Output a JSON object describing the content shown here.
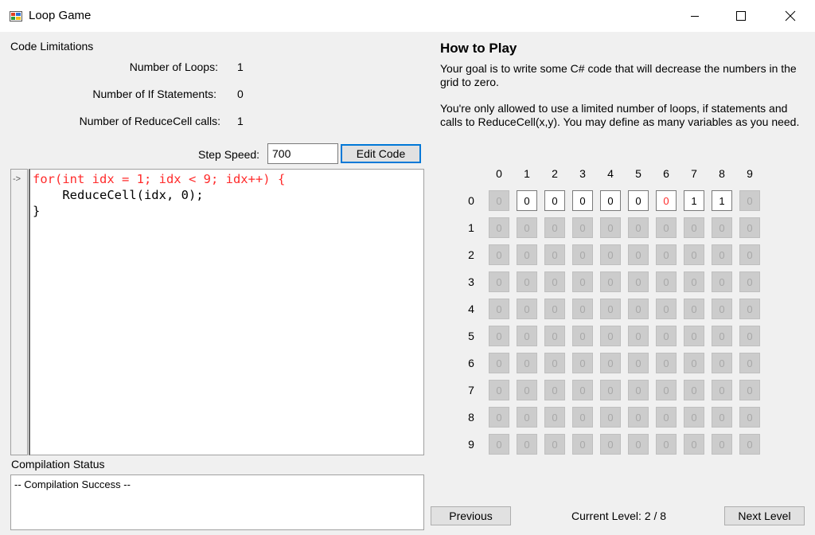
{
  "window": {
    "title": "Loop Game"
  },
  "limits": {
    "heading": "Code Limitations",
    "loops_label": "Number of Loops:",
    "loops_value": "1",
    "if_label": "Number of If Statements:",
    "if_value": "0",
    "reduce_label": "Number of ReduceCell calls:",
    "reduce_value": "1"
  },
  "speed": {
    "label": "Step Speed:",
    "value": "700"
  },
  "edit_label": "Edit Code",
  "gutter_arrow": "->",
  "code_lines": [
    {
      "text": "for(int idx = 1; idx < 9; idx++) {",
      "color": "#ff2b2b"
    },
    {
      "text": "    ReduceCell(idx, 0);",
      "color": "#000000"
    },
    {
      "text": "}",
      "color": "#000000"
    }
  ],
  "compilation": {
    "heading": "Compilation Status",
    "message": "-- Compilation Success --"
  },
  "help": {
    "title": "How to Play",
    "para1": "Your goal is to write some C# code that will decrease the numbers in the grid to zero.",
    "para2": "You're only allowed to use a limited number of loops, if statements and calls to ReduceCell(x,y). You may define as many variables as you need."
  },
  "grid": {
    "col_labels": [
      "0",
      "1",
      "2",
      "3",
      "4",
      "5",
      "6",
      "7",
      "8",
      "9"
    ],
    "row_labels": [
      "0",
      "1",
      "2",
      "3",
      "4",
      "5",
      "6",
      "7",
      "8",
      "9"
    ],
    "highlight_color": "#ff2b2b",
    "active_row0": [
      {
        "col": 1,
        "value": "0",
        "highlight": false
      },
      {
        "col": 2,
        "value": "0",
        "highlight": false
      },
      {
        "col": 3,
        "value": "0",
        "highlight": false
      },
      {
        "col": 4,
        "value": "0",
        "highlight": false
      },
      {
        "col": 5,
        "value": "0",
        "highlight": false
      },
      {
        "col": 6,
        "value": "0",
        "highlight": true
      },
      {
        "col": 7,
        "value": "1",
        "highlight": false
      },
      {
        "col": 8,
        "value": "1",
        "highlight": false
      }
    ],
    "inactive_value": "0"
  },
  "footer": {
    "previous_label": "Previous",
    "level_text": "Current Level: 2 / 8",
    "next_label": "Next Level"
  }
}
